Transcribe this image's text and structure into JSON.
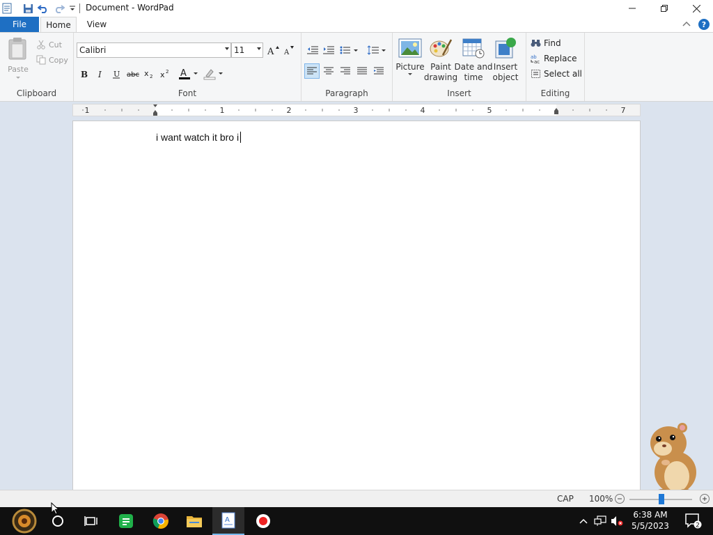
{
  "window": {
    "title": "Document - WordPad"
  },
  "tabs": {
    "file": "File",
    "home": "Home",
    "view": "View"
  },
  "clipboard": {
    "paste": "Paste",
    "cut": "Cut",
    "copy": "Copy",
    "label": "Clipboard"
  },
  "font": {
    "family": "Calibri",
    "size": "11",
    "label": "Font"
  },
  "paragraph": {
    "label": "Paragraph"
  },
  "insert": {
    "picture": "Picture",
    "paint_drawing": "Paint\ndrawing",
    "date_time": "Date and\ntime",
    "insert_object": "Insert\nobject",
    "label": "Insert"
  },
  "editing": {
    "find": "Find",
    "replace": "Replace",
    "select_all": "Select all",
    "label": "Editing"
  },
  "ruler": {
    "numbers": [
      "1",
      "1",
      "2",
      "3",
      "4",
      "5",
      "7"
    ]
  },
  "document": {
    "text": "i want watch it bro i"
  },
  "status": {
    "caps": "CAP",
    "zoom": "100%"
  },
  "taskbar": {
    "time": "6:38 AM",
    "date": "5/5/2023",
    "notifications": "2"
  },
  "colors": {
    "accent": "#1e6fc3",
    "font_color_bar": "#000000",
    "highlight_bar": "#ffffff",
    "taskbar": "#101010"
  }
}
